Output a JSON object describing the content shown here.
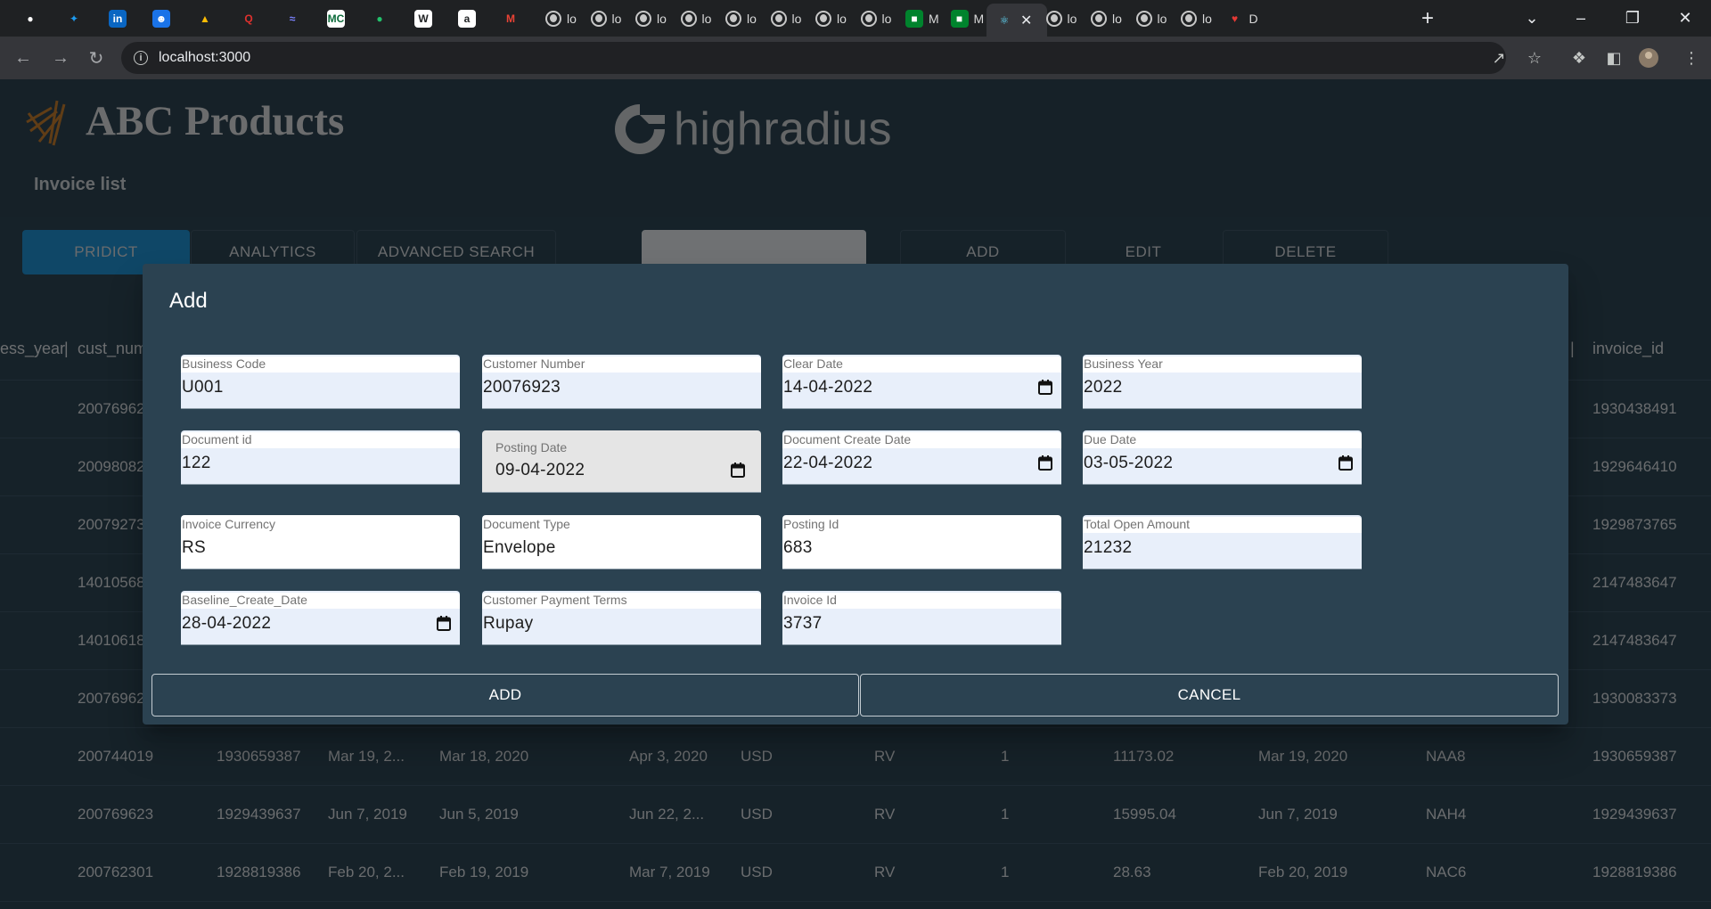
{
  "browser": {
    "tabs": [
      {
        "icon": "github-icon",
        "label": ""
      },
      {
        "icon": "twitter-icon",
        "label": ""
      },
      {
        "icon": "linkedin-icon",
        "label": ""
      },
      {
        "icon": "contacts-icon",
        "label": ""
      },
      {
        "icon": "drive-icon",
        "label": ""
      },
      {
        "icon": "quora-icon",
        "label": ""
      },
      {
        "icon": "site-icon",
        "label": ""
      },
      {
        "icon": "moneycontrol-icon",
        "label": ""
      },
      {
        "icon": "edge-icon",
        "label": ""
      },
      {
        "icon": "wikipedia-icon",
        "label": ""
      },
      {
        "icon": "amazon-icon",
        "label": ""
      },
      {
        "icon": "gmail-icon",
        "label": ""
      },
      {
        "icon": "globe-icon",
        "label": "lo"
      },
      {
        "icon": "globe-icon",
        "label": "lo"
      },
      {
        "icon": "globe-icon",
        "label": "lo"
      },
      {
        "icon": "globe-icon",
        "label": "lo"
      },
      {
        "icon": "globe-icon",
        "label": "lo"
      },
      {
        "icon": "globe-icon",
        "label": "lo"
      },
      {
        "icon": "globe-icon",
        "label": "lo"
      },
      {
        "icon": "globe-icon",
        "label": "lo"
      },
      {
        "icon": "meet-icon",
        "label": "M"
      },
      {
        "icon": "meet-icon",
        "label": "M"
      },
      {
        "icon": "react-icon",
        "label": ""
      },
      {
        "icon": "globe-icon",
        "label": "lo"
      },
      {
        "icon": "globe-icon",
        "label": "lo"
      },
      {
        "icon": "globe-icon",
        "label": "lo"
      },
      {
        "icon": "globe-icon",
        "label": "lo"
      },
      {
        "icon": "heart-icon",
        "label": "D"
      }
    ],
    "url": "localhost:3000"
  },
  "header": {
    "brand": "ABC Products",
    "partner": "highradius",
    "subtitle": "Invoice list"
  },
  "controls": {
    "predict": "PRIDICT",
    "analytics": "ANALYTICS",
    "advanced_search": "ADVANCED SEARCH",
    "add": "ADD",
    "edit": "EDIT",
    "delete": "DELETE"
  },
  "grid": {
    "headers_left": [
      "ess_year",
      "|",
      "cust_num"
    ],
    "headers_right": [
      "s |",
      "invoice_id"
    ],
    "partial_rows": [
      {
        "cust": "20076962",
        "invoice": "1930438491"
      },
      {
        "cust": "20098082",
        "invoice": "1929646410"
      },
      {
        "cust": "20079273",
        "invoice": "1929873765"
      },
      {
        "cust": "14010568",
        "invoice": "2147483647"
      },
      {
        "cust": "14010618",
        "invoice": "2147483647"
      },
      {
        "cust": "20076962",
        "invoice": "1930083373"
      }
    ],
    "rows": [
      {
        "cells": [
          "200744019",
          "1930659387",
          "Mar 19, 2...",
          "Mar 18, 2020",
          "Apr 3, 2020",
          "USD",
          "RV",
          "1",
          "11173.02",
          "Mar 19, 2020",
          "NAA8",
          "1930659387"
        ]
      },
      {
        "cells": [
          "200769623",
          "1929439637",
          "Jun 7, 2019",
          "Jun 5, 2019",
          "Jun 22, 2...",
          "USD",
          "RV",
          "1",
          "15995.04",
          "Jun 7, 2019",
          "NAH4",
          "1929439637"
        ]
      },
      {
        "cells": [
          "200762301",
          "1928819386",
          "Feb 20, 2...",
          "Feb 19, 2019",
          "Mar 7, 2019",
          "USD",
          "RV",
          "1",
          "28.63",
          "Feb 20, 2019",
          "NAC6",
          "1928819386"
        ]
      }
    ]
  },
  "dialog": {
    "title": "Add",
    "fields": [
      {
        "label": "Business Code",
        "value": "U001"
      },
      {
        "label": "Customer Number",
        "value": "20076923"
      },
      {
        "label": "Clear Date",
        "value": "14-04-2022"
      },
      {
        "label": "Business Year",
        "value": "2022"
      },
      {
        "label": "Document id",
        "value": "122"
      },
      {
        "label": "Posting Date",
        "value": "09-04-2022"
      },
      {
        "label": "Document Create Date",
        "value": "22-04-2022"
      },
      {
        "label": "Due Date",
        "value": "03-05-2022"
      },
      {
        "label": "Invoice Currency",
        "value": "RS"
      },
      {
        "label": "Document Type",
        "value": "Envelope"
      },
      {
        "label": "Posting Id",
        "value": "683"
      },
      {
        "label": "Total Open Amount",
        "value": "21232"
      },
      {
        "label": "Baseline_Create_Date",
        "value": "28-04-2022"
      },
      {
        "label": "Customer Payment Terms",
        "value": "Rupay"
      },
      {
        "label": "Invoice Id",
        "value": "3737"
      }
    ],
    "add_label": "ADD",
    "cancel_label": "CANCEL"
  }
}
